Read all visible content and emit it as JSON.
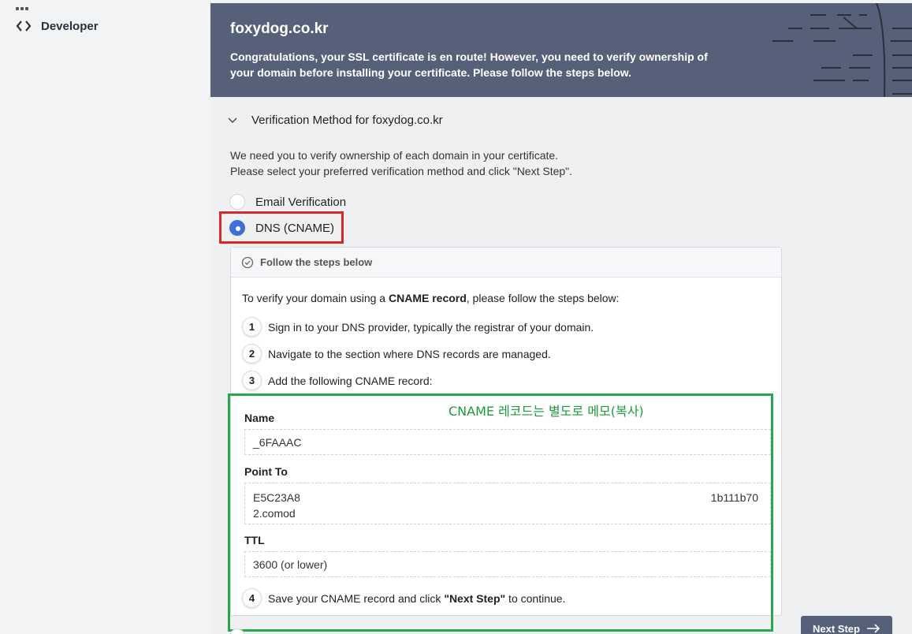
{
  "sidebar": {
    "developer_label": "Developer"
  },
  "hero": {
    "domain": "foxydog.co.kr",
    "message": "Congratulations, your SSL certificate is en route! However, you need to verify ownership of your domain before installing your certificate. Please follow the steps below."
  },
  "method": {
    "heading": "Verification Method for foxydog.co.kr",
    "intro_line1": "We need you to verify ownership of each domain in your certificate.",
    "intro_line2": "Please select your preferred verification method and click \"Next Step\".",
    "option_email": "Email Verification",
    "option_dns": "DNS (CNAME)",
    "selected": "DNS (CNAME)"
  },
  "steps_card": {
    "header": "Follow the steps below",
    "lead_prefix": "To verify your domain using a ",
    "lead_bold": "CNAME record",
    "lead_suffix": ", please follow the steps below:",
    "step1_num": "1",
    "step1": "Sign in to your DNS provider, typically the registrar of your domain.",
    "step2_num": "2",
    "step2": "Navigate to the section where DNS records are managed.",
    "step3_num": "3",
    "step3": "Add the following CNAME record:",
    "annotation": "CNAME 레코드는 별도로 메모(복사)",
    "name_label": "Name",
    "name_value": "_6FAAAC",
    "point_label": "Point To",
    "point_value_line1": "E5C23A8",
    "point_value_line1_right": "1b111b70",
    "point_value_line2": "2.comod",
    "ttl_label": "TTL",
    "ttl_value": "3600 (or lower)",
    "step4_num": "4",
    "step4_prefix": "Save your CNAME record and click ",
    "step4_bold": "\"Next Step\"",
    "step4_suffix": " to continue."
  },
  "footer": {
    "next_label": "Next Step"
  },
  "colors": {
    "hero_bg": "#566079",
    "radio_selected": "#3f6fd8",
    "highlight_red": "#d42a2a",
    "highlight_green": "#27a84a"
  }
}
